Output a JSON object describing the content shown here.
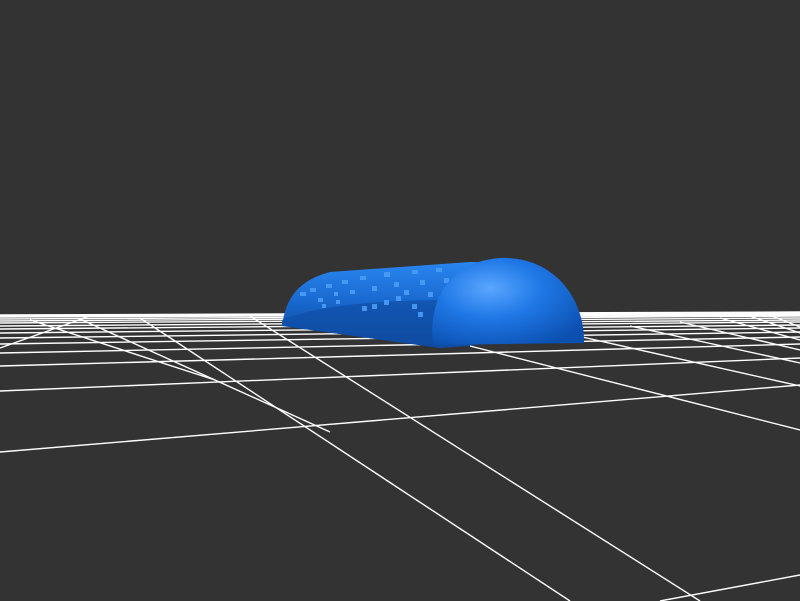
{
  "scene": {
    "background_color": "#333333",
    "grid_color": "#ffffff",
    "model_color": "#1f78e6",
    "model_shadow_color": "#0d4aa0",
    "model_highlight_color": "#5aa6ff"
  }
}
